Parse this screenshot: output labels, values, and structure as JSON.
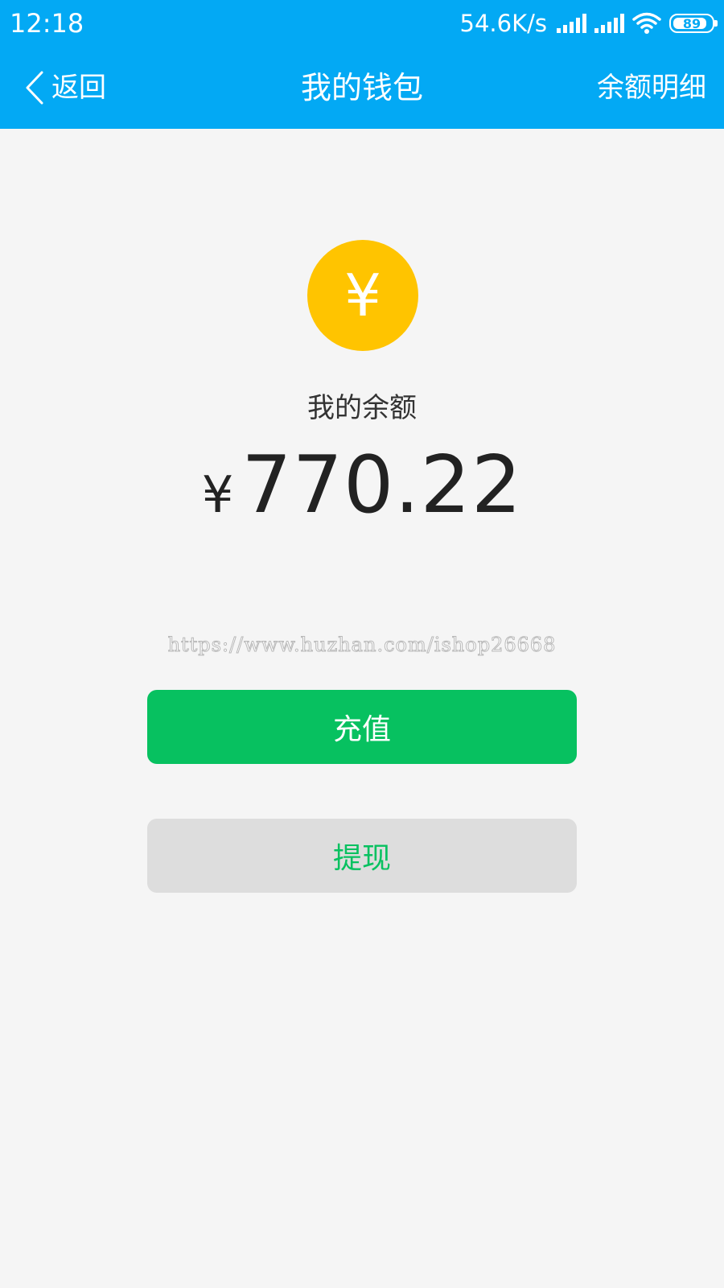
{
  "status_bar": {
    "time": "12:18",
    "net_speed": "54.6K/s",
    "battery": "89"
  },
  "nav": {
    "back_label": "返回",
    "title": "我的钱包",
    "right_label": "余额明细"
  },
  "wallet": {
    "coin_glyph": "¥",
    "balance_label": "我的余额",
    "currency_symbol": "¥",
    "amount": "770.22"
  },
  "watermark": "https://www.huzhan.com/ishop26668",
  "actions": {
    "recharge_label": "充值",
    "withdraw_label": "提现"
  },
  "colors": {
    "header": "#03a9f4",
    "coin": "#ffc400",
    "primary_green": "#07c160",
    "secondary_button": "#dddddd",
    "background": "#f5f5f5"
  }
}
